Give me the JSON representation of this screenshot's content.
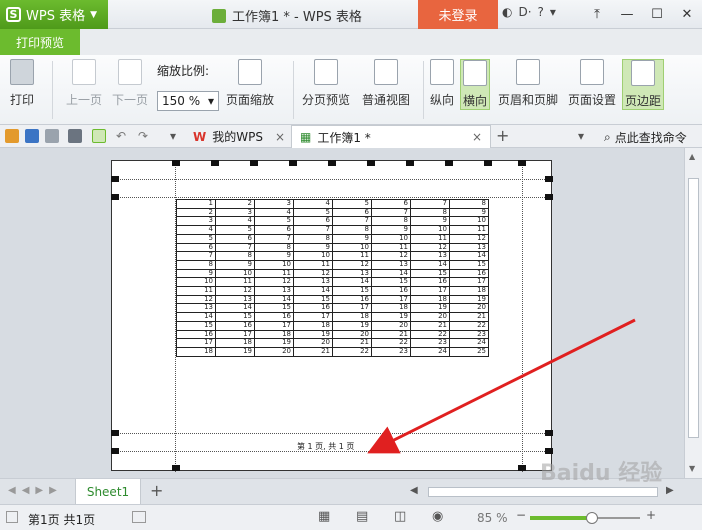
{
  "titlebar": {
    "app_name": "WPS 表格",
    "doc_title": "工作簿1 * - WPS 表格",
    "login_label": "未登录",
    "help": "?"
  },
  "ribbon_tab": "打印预览",
  "ribbon": {
    "print": "打印",
    "prev_page": "上一页",
    "next_page": "下一页",
    "zoom_label": "缩放比例:",
    "zoom_value": "150 %",
    "page_zoom": "页面缩放",
    "page_break_preview": "分页预览",
    "normal_view": "普通视图",
    "portrait": "纵向",
    "landscape": "横向",
    "header_footer": "页眉和页脚",
    "page_setup": "页面设置",
    "margins": "页边距"
  },
  "doc_tabs": {
    "my_wps": "我的WPS",
    "workbook": "工作簿1 *",
    "search_cmd": "点此查找命令"
  },
  "table": {
    "rows": [
      [
        1,
        2,
        3,
        4,
        5,
        6,
        7,
        8
      ],
      [
        2,
        3,
        4,
        5,
        6,
        7,
        8,
        9
      ],
      [
        3,
        4,
        5,
        6,
        7,
        8,
        9,
        10
      ],
      [
        4,
        5,
        6,
        7,
        8,
        9,
        10,
        11
      ],
      [
        5,
        6,
        7,
        8,
        9,
        10,
        11,
        12
      ],
      [
        6,
        7,
        8,
        9,
        10,
        11,
        12,
        13
      ],
      [
        7,
        8,
        9,
        10,
        11,
        12,
        13,
        14
      ],
      [
        8,
        9,
        10,
        11,
        12,
        13,
        14,
        15
      ],
      [
        9,
        10,
        11,
        12,
        13,
        14,
        15,
        16
      ],
      [
        10,
        11,
        12,
        13,
        14,
        15,
        16,
        17
      ],
      [
        11,
        12,
        13,
        14,
        15,
        16,
        17,
        18
      ],
      [
        12,
        13,
        14,
        15,
        16,
        17,
        18,
        19
      ],
      [
        13,
        14,
        15,
        16,
        17,
        18,
        19,
        20
      ],
      [
        14,
        15,
        16,
        17,
        18,
        19,
        20,
        21
      ],
      [
        15,
        16,
        17,
        18,
        19,
        20,
        21,
        22
      ],
      [
        16,
        17,
        18,
        19,
        20,
        21,
        22,
        23
      ],
      [
        17,
        18,
        19,
        20,
        21,
        22,
        23,
        24
      ],
      [
        18,
        19,
        20,
        21,
        22,
        23,
        24,
        25
      ]
    ]
  },
  "page_footer": "第 1 页, 共 1 页",
  "sheet_tab": "Sheet1",
  "status": {
    "page_info": "第1页 共1页",
    "zoom_percent": "85 %",
    "zoom_level": 0.85
  },
  "watermark": "Baidu 经验",
  "colors": {
    "accent": "#6cbb2e",
    "login": "#e8653f",
    "arrow": "#e02020"
  }
}
